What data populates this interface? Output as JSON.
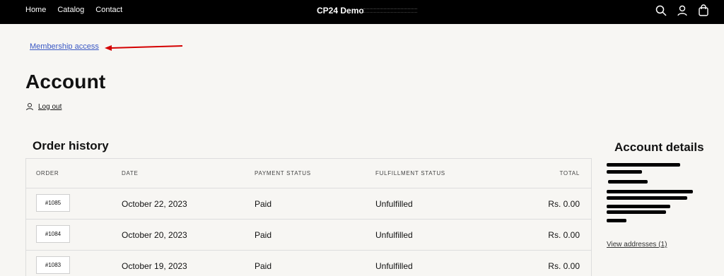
{
  "nav": {
    "items": [
      "Home",
      "Catalog",
      "Contact"
    ],
    "brand": "CP24 Demo"
  },
  "header_icons": [
    "search-icon",
    "user-icon",
    "cart-icon"
  ],
  "links": {
    "membership": "Membership access"
  },
  "page": {
    "title": "Account",
    "logout": "Log out"
  },
  "orders": {
    "heading": "Order history",
    "columns": [
      "ORDER",
      "DATE",
      "PAYMENT STATUS",
      "FULFILLMENT STATUS",
      "TOTAL"
    ],
    "rows": [
      {
        "order": "#1085",
        "date": "October 22, 2023",
        "payment": "Paid",
        "fulfillment": "Unfulfilled",
        "total": "Rs. 0.00"
      },
      {
        "order": "#1084",
        "date": "October 20, 2023",
        "payment": "Paid",
        "fulfillment": "Unfulfilled",
        "total": "Rs. 0.00"
      },
      {
        "order": "#1083",
        "date": "October 19, 2023",
        "payment": "Paid",
        "fulfillment": "Unfulfilled",
        "total": "Rs. 0.00"
      }
    ]
  },
  "account": {
    "heading": "Account details",
    "view_addresses": "View addresses (1)"
  },
  "colors": {
    "topbar": "#000000",
    "link": "#3a58c4",
    "annotation_arrow": "#d40000"
  }
}
